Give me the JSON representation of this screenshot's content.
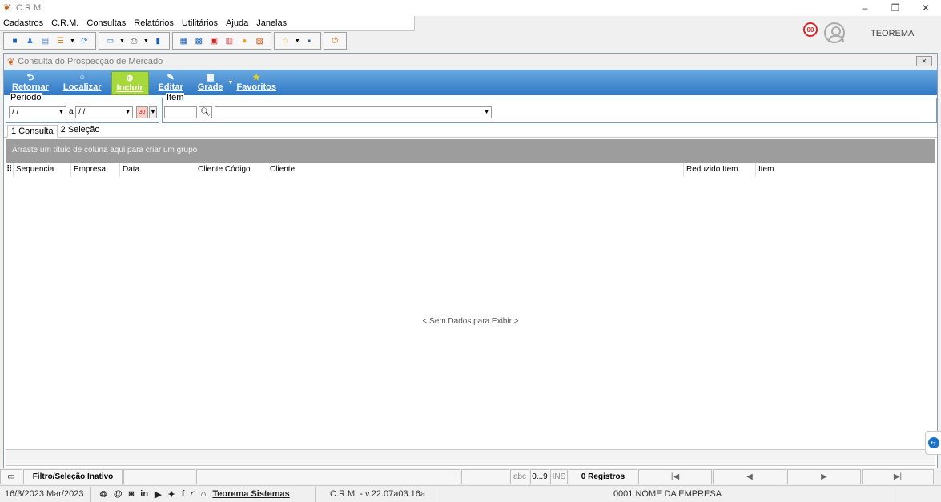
{
  "window": {
    "title": "C.R.M.",
    "controls": {
      "minimize": "–",
      "restore": "❐",
      "close": "✕"
    }
  },
  "menu": [
    {
      "label": "Cadastros",
      "underline": "C"
    },
    {
      "label": "C.R.M.",
      "underline": "R"
    },
    {
      "label": "Consultas",
      "underline": "t"
    },
    {
      "label": "Relatórios",
      "underline": "R"
    },
    {
      "label": "Utilitários",
      "underline": "U"
    },
    {
      "label": "Ajuda",
      "underline": "A"
    },
    {
      "label": "Janelas",
      "underline": "J"
    }
  ],
  "header": {
    "notification_count": "00",
    "username": "TEOREMA"
  },
  "child_window": {
    "title": "Consulta do Prospecção de Mercado",
    "close_label": "✕"
  },
  "ribbon": {
    "retornar": "Retornar",
    "localizar": "Localizar",
    "incluir": "Incluir",
    "editar": "Editar",
    "grade": "Grade",
    "favoritos": "Favoritos"
  },
  "filters": {
    "periodo_label": "Período",
    "date_from": " / /",
    "between": "a",
    "date_to": " / /",
    "cal_label": "30",
    "item_label": "Item",
    "item_code": "",
    "item_desc": ""
  },
  "tabs": [
    {
      "label": "1 Consulta",
      "active": true
    },
    {
      "label": "2 Seleção",
      "active": false
    }
  ],
  "grid": {
    "group_hint": "Arraste um título de coluna aqui para criar um grupo",
    "columns": [
      "Sequencia",
      "Empresa",
      "Data",
      "Cliente Código",
      "Cliente",
      "Reduzido Item",
      "Item"
    ],
    "empty_message": "< Sem Dados para Exibir >"
  },
  "status": {
    "filter_state": "Filtro/Seleção Inativo",
    "abc": "abc",
    "digits": "0...9",
    "ins": "INS",
    "records": "0 Registros",
    "nav_first": "|◀",
    "nav_prev": "◀",
    "nav_next": "▶",
    "nav_last": "▶|"
  },
  "footer": {
    "date": "16/3/2023 Mar/2023",
    "company_link": "Teorema Sistemas",
    "version": "C.R.M. - v.22.07a03.16a",
    "company_name": "0001 NOME DA EMPRESA"
  }
}
